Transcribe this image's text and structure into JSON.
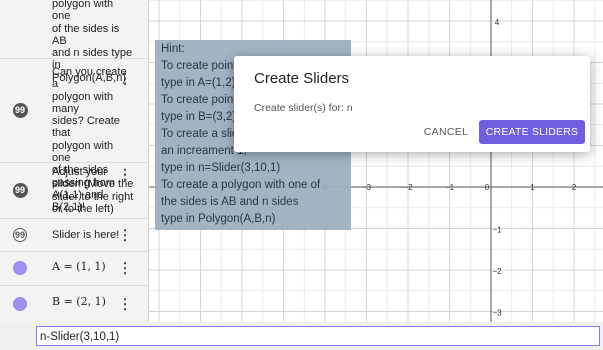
{
  "algebra": {
    "items": [
      {
        "text": "polygon with one\nof the sides is AB\nand n sides type\nin Polygon(A,B,n)",
        "marker": "none",
        "menu": ""
      },
      {
        "text": "Can you create a\npolygon with many\nsides? Create that\npolygon with one\nof the sides\npassing from\nA(1,1) and B(2,1)!",
        "marker": "quote-filled",
        "menu": "⋮"
      },
      {
        "text": "Adjust your\nslider! (Move the\nslider to the right\nor to the left)",
        "marker": "quote-filled",
        "menu": "⋮"
      },
      {
        "text": "Slider is here!",
        "marker": "quote-outline",
        "menu": "⋮"
      },
      {
        "text": "A = (1, 1)",
        "marker": "point",
        "menu": "⋮"
      },
      {
        "text": "B = (2, 1)",
        "marker": "point",
        "menu": "⋮"
      }
    ],
    "quote_glyph": "99"
  },
  "hint": {
    "lines": [
      "Hint:",
      "To create point A=(1,2)",
      "type in A=(1,2)",
      "To create point B=(3,2)",
      "type in B=(3,2)",
      "To create a slider with",
      "an increament 1,",
      "type in n=Slider(3,10,1)",
      "To create a polygon with one of",
      "the sides is AB and n sides",
      "type in Polygon(A,B,n)"
    ]
  },
  "graph": {
    "x_tick_labels": [
      "4",
      "−3",
      "−2",
      "−1",
      "0",
      "1",
      "2"
    ],
    "y_tick_labels": [
      "4",
      "−1",
      "−2",
      "−3"
    ],
    "grid_color": "#e6e6e6",
    "axis_color": "#555555"
  },
  "dialog": {
    "title": "Create Sliders",
    "message": "Create slider(s) for: n",
    "cancel_label": "CANCEL",
    "create_label": "CREATE SLIDERS",
    "accent": "#6f5fe0"
  },
  "input_bar": {
    "value": "n-Slider(3,10,1)"
  }
}
